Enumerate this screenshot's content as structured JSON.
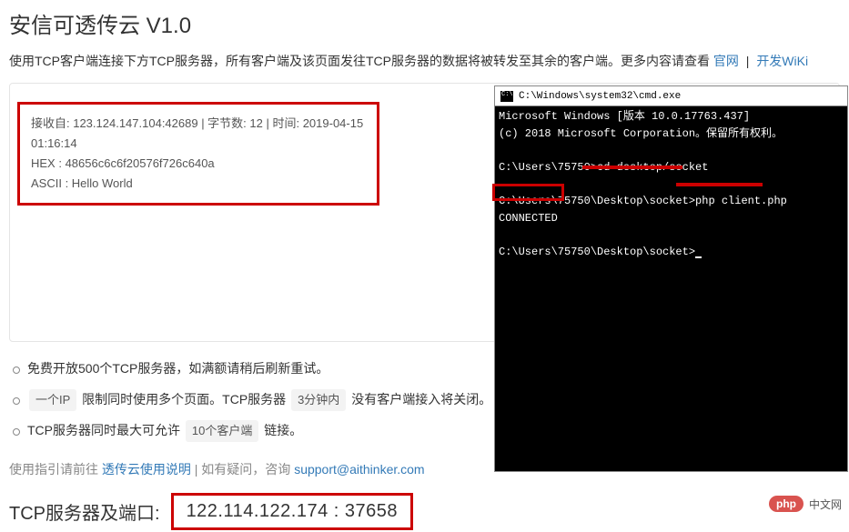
{
  "title": "安信可透传云 V1.0",
  "intro": {
    "text": "使用TCP客户端连接下方TCP服务器，所有客户端及该页面发往TCP服务器的数据将被转发至其余的客户端。更多内容请查看 ",
    "link1": "官网",
    "sep": "|",
    "link2": "开发WiKi"
  },
  "received": {
    "meta": "接收自: 123.124.147.104:42689 | 字节数: 12 | 时间: 2019-04-15 01:16:14",
    "hex": "HEX   : 48656c6c6f20576f726c640a",
    "ascii": "ASCII : Hello World"
  },
  "cmd": {
    "title": "C:\\Windows\\system32\\cmd.exe",
    "l1": "Microsoft Windows [版本 10.0.17763.437]",
    "l2": "(c) 2018 Microsoft Corporation。保留所有权利。",
    "l3": "",
    "l4": "C:\\Users\\75750>cd desktop/socket",
    "l5": "",
    "l6": "C:\\Users\\75750\\Desktop\\socket>php client.php",
    "l7": "CONNECTED",
    "l8": "",
    "l9": "C:\\Users\\75750\\Desktop\\socket>"
  },
  "bullets": {
    "b1a": "免费开放500个TCP服务器，如满额请稍后刷新重试。",
    "b2a": "一个IP",
    "b2b": " 限制同时使用多个页面。TCP服务器 ",
    "b2c": "3分钟内",
    "b2d": " 没有客户端接入将关闭。",
    "b3a": "TCP服务器同时最大可允许 ",
    "b3b": "10个客户端",
    "b3c": " 链接。"
  },
  "guide": {
    "pre": "使用指引请前往 ",
    "link": "透传云使用说明",
    "mid": " | 如有疑问，咨询 ",
    "email": "support@aithinker.com"
  },
  "serverport": {
    "label": "TCP服务器及端口:",
    "value": "122.114.122.174 : 37658"
  },
  "watermark": {
    "pill": "php",
    "text": "中文网"
  }
}
